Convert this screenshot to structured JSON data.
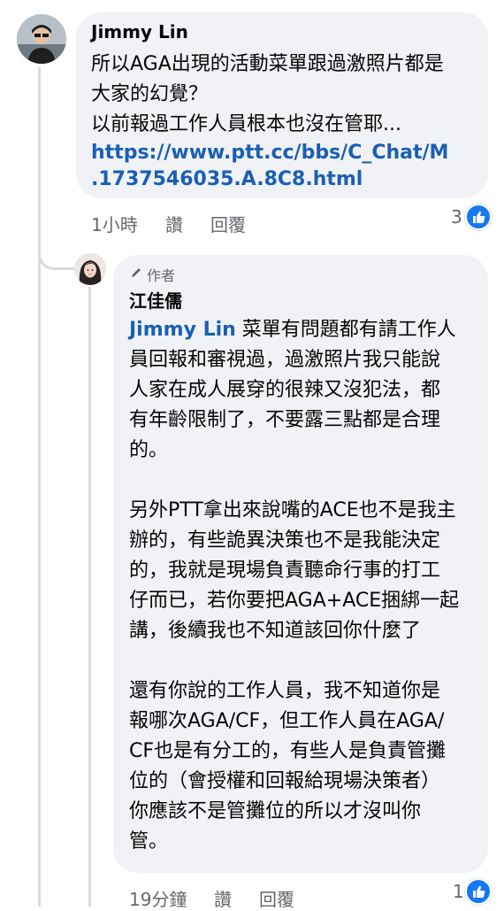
{
  "comment1": {
    "author": "Jimmy Lin",
    "lines": [
      "所以AGA出現的活動菜單跟過激照片都是",
      "大家的幻覺？",
      "以前報過工作人員根本也沒在管耶..."
    ],
    "link_lines": [
      "https://www.ptt.cc/bbs/C_Chat/M",
      ".1737546035.A.8C8.html"
    ],
    "time": "1小時",
    "like_label": "讚",
    "reply_label": "回覆",
    "reaction_count": "3"
  },
  "reply1": {
    "author_badge": "作者",
    "author": "江佳儒",
    "mention": "Jimmy Lin",
    "para1_first": " 菜單有問題都有請工作人",
    "para1_rest": [
      "員回報和審視過，過激照片我只能說",
      "人家在成人展穿的很辣又沒犯法，都",
      "有年齡限制了，不要露三點都是合理",
      "的。"
    ],
    "para2": [
      "另外PTT拿出來說嘴的ACE也不是我主",
      "辦的，有些詭異決策也不是我能決定",
      "的，我就是現場負責聽命行事的打工",
      "仔而已，若你要把AGA+ACE捆綁一起",
      "講，後續我也不知道該回你什麼了"
    ],
    "para3": [
      "還有你說的工作人員，我不知道你是",
      "報哪次AGA/CF，但工作人員在AGA/",
      "CF也是有分工的，有些人是負責管攤",
      "位的（會授權和回報給現場決策者）",
      "你應該不是管攤位的所以才沒叫你",
      "管。"
    ],
    "time": "19分鐘",
    "like_label": "讚",
    "reply_label": "回覆",
    "reaction_count": "1"
  },
  "colors": {
    "link": "#1a5fb4",
    "like_blue": "#1877f2",
    "bubble": "#f0f2f5"
  }
}
